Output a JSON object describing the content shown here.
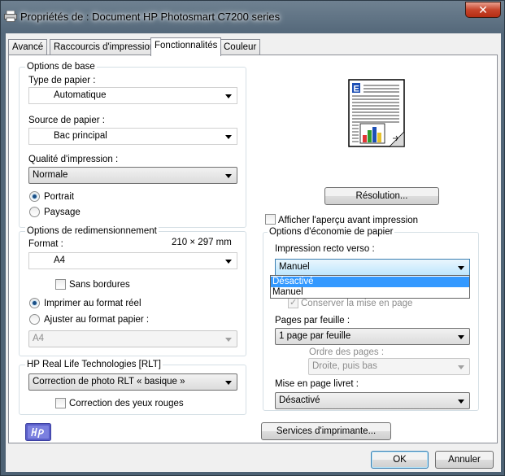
{
  "window": {
    "title": "Propriétés de : Document HP Photosmart C7200 series",
    "close_glyph": "✕"
  },
  "tabs": [
    {
      "label": "Avancé"
    },
    {
      "label": "Raccourcis d'impression"
    },
    {
      "label": "Fonctionnalités"
    },
    {
      "label": "Couleur"
    }
  ],
  "basic": {
    "group_title": "Options de base",
    "paper_type_label": "Type de papier :",
    "paper_type_value": "Automatique",
    "paper_source_label": "Source de papier :",
    "paper_source_value": "Bac principal",
    "quality_label": "Qualité d'impression :",
    "quality_value": "Normale",
    "portrait_label": "Portrait",
    "landscape_label": "Paysage"
  },
  "resize": {
    "group_title": "Options de redimensionnement",
    "format_label": "Format :",
    "format_dims": "210 × 297 mm",
    "format_value": "A4",
    "borderless_label": "Sans bordures",
    "actual_size_label": "Imprimer au format réel",
    "fit_label": "Ajuster au format papier :",
    "fit_value": "A4"
  },
  "reallife": {
    "group_title": "HP Real Life Technologies [RLT]",
    "correction_value": "Correction de photo RLT « basique »",
    "redeye_label": "Correction des yeux rouges"
  },
  "right": {
    "resolution_button": "Résolution...",
    "preview_label": "Afficher l'aperçu avant impression",
    "paper_saving_title": "Options d'économie de papier",
    "duplex_label": "Impression recto verso :",
    "duplex_value": "Manuel",
    "duplex_options": [
      "Désactivé",
      "Manuel"
    ],
    "keep_layout_label": "Conserver la mise en page",
    "pages_per_sheet_label": "Pages par feuille :",
    "pages_per_sheet_value": "1 page par feuille",
    "page_order_label": "Ordre des pages :",
    "page_order_value": "Droite, puis bas",
    "booklet_label": "Mise en page livret :",
    "booklet_value": "Désactivé",
    "printer_services_button": "Services d'imprimante..."
  },
  "footer": {
    "ok_label": "OK",
    "cancel_label": "Annuler"
  },
  "colors": {
    "selection": "#3399ff",
    "close_button": "#c7452b",
    "title_gradient": "#54687a"
  }
}
